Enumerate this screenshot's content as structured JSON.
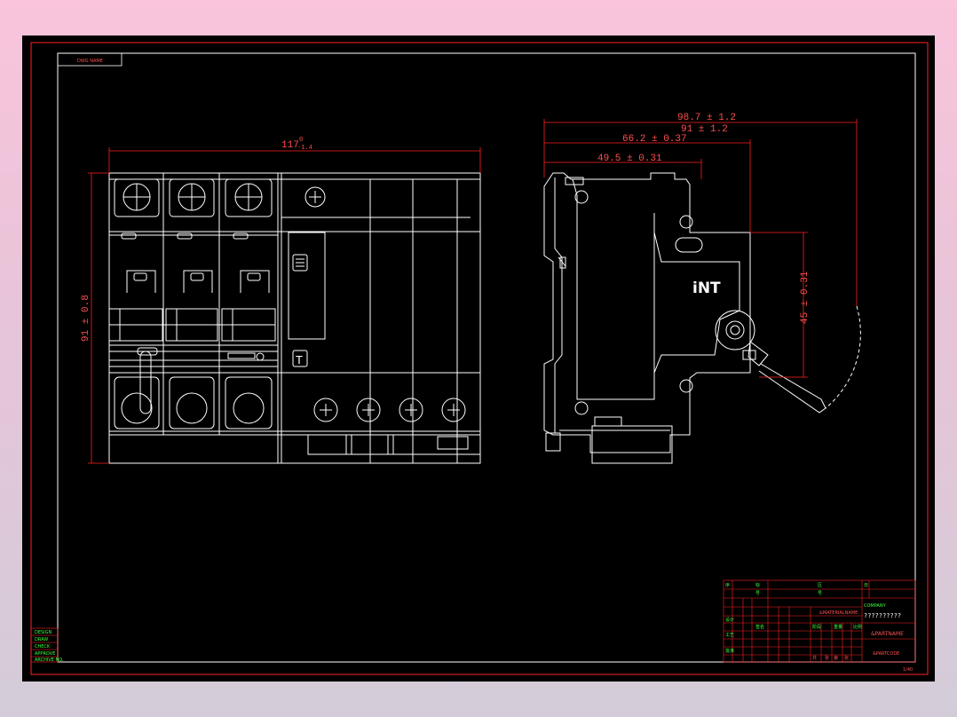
{
  "drawing": {
    "corner_label": "DWG NAME",
    "front_view": {
      "width_dim": "117",
      "width_tol_upper": "0",
      "width_tol_lower": "-1.4",
      "height_dim": "91 ± 0.8"
    },
    "side_view": {
      "dims": [
        "98.7 ± 1.2",
        "91 ± 1.2",
        "66.2 ± 0.37",
        "49.5 ± 0.31"
      ],
      "handle_dim": "45 ± 0.31",
      "brand": "iNT"
    },
    "title_block": {
      "company": "COMPANY",
      "question_marks": "??????????",
      "partname": "&PARTNAME",
      "drawing_number": "&PARTNAME",
      "part_code": "&PARTCODE",
      "scale_small": "1/40"
    },
    "side_stamp": [
      "DESIGN",
      "DRAW",
      "CHECK",
      "APPROVE",
      "ARCHIVE NO."
    ]
  },
  "colors": {
    "frame": "#ff2020",
    "outline": "#ffffff",
    "text_green": "#3cff3c",
    "text_red": "#ff4d4d"
  }
}
